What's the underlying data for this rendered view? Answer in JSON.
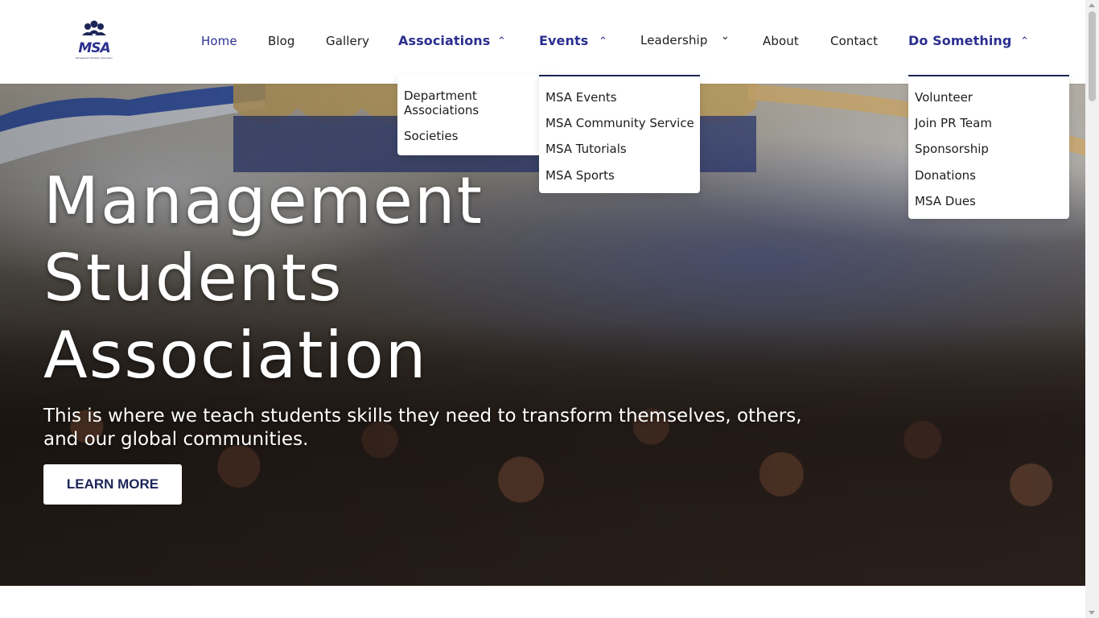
{
  "colors": {
    "brand": "#2b2f8f",
    "dark_navy": "#1c2557",
    "text": "#1d1d1d"
  },
  "header": {
    "logo_text": "MSA",
    "logo_caption": "Management Students' Association",
    "nav": {
      "home": "Home",
      "blog": "Blog",
      "gallery": "Gallery",
      "associations": "Associations",
      "events": "Events",
      "leadership": "Leadership",
      "about": "About",
      "contact": "Contact",
      "do_something": "Do Something"
    },
    "carets": {
      "up": "⌃",
      "down": "⌄"
    }
  },
  "dropdowns": {
    "associations": [
      "Department Associations",
      "Societies"
    ],
    "events": [
      "MSA Events",
      "MSA Community Service",
      "MSA Tutorials",
      "MSA Sports"
    ],
    "do_something": [
      "Volunteer",
      "Join PR Team",
      "Sponsorship",
      "Donations",
      "MSA Dues"
    ]
  },
  "hero": {
    "title_lines": [
      "Management",
      "Students",
      "Association"
    ],
    "subtitle_lines": [
      "This is where we teach students skills they need to transform themselves, others,",
      "and our global communities."
    ],
    "cta_label": "LEARN MORE"
  }
}
